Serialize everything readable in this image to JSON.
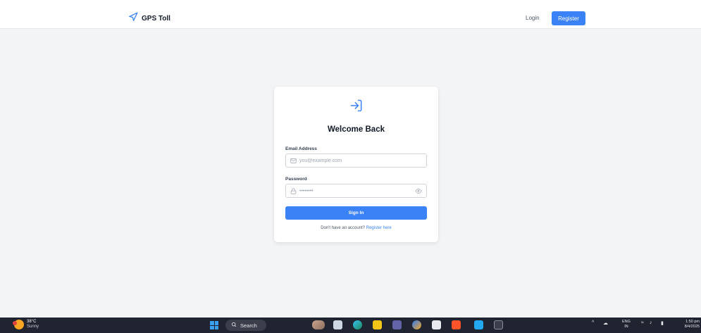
{
  "navbar": {
    "brand": "GPS Toll",
    "login_label": "Login",
    "register_label": "Register"
  },
  "login_card": {
    "title": "Welcome Back",
    "email_label": "Email Address",
    "email_placeholder": "you@example.com",
    "password_label": "Password",
    "password_placeholder": "••••••••",
    "signin_label": "Sign In",
    "footer_text": "Don't have an account?",
    "footer_link": "Register here"
  },
  "taskbar": {
    "weather_temp": "38°C",
    "weather_desc": "Sunny",
    "search_label": "Search",
    "lang_top": "ENG",
    "lang_bottom": "IN",
    "time": "1:50 pm",
    "date": "8/4/2025"
  },
  "colors": {
    "accent": "#3b82f6",
    "background": "#f3f4f6",
    "taskbar": "#1f2430"
  }
}
